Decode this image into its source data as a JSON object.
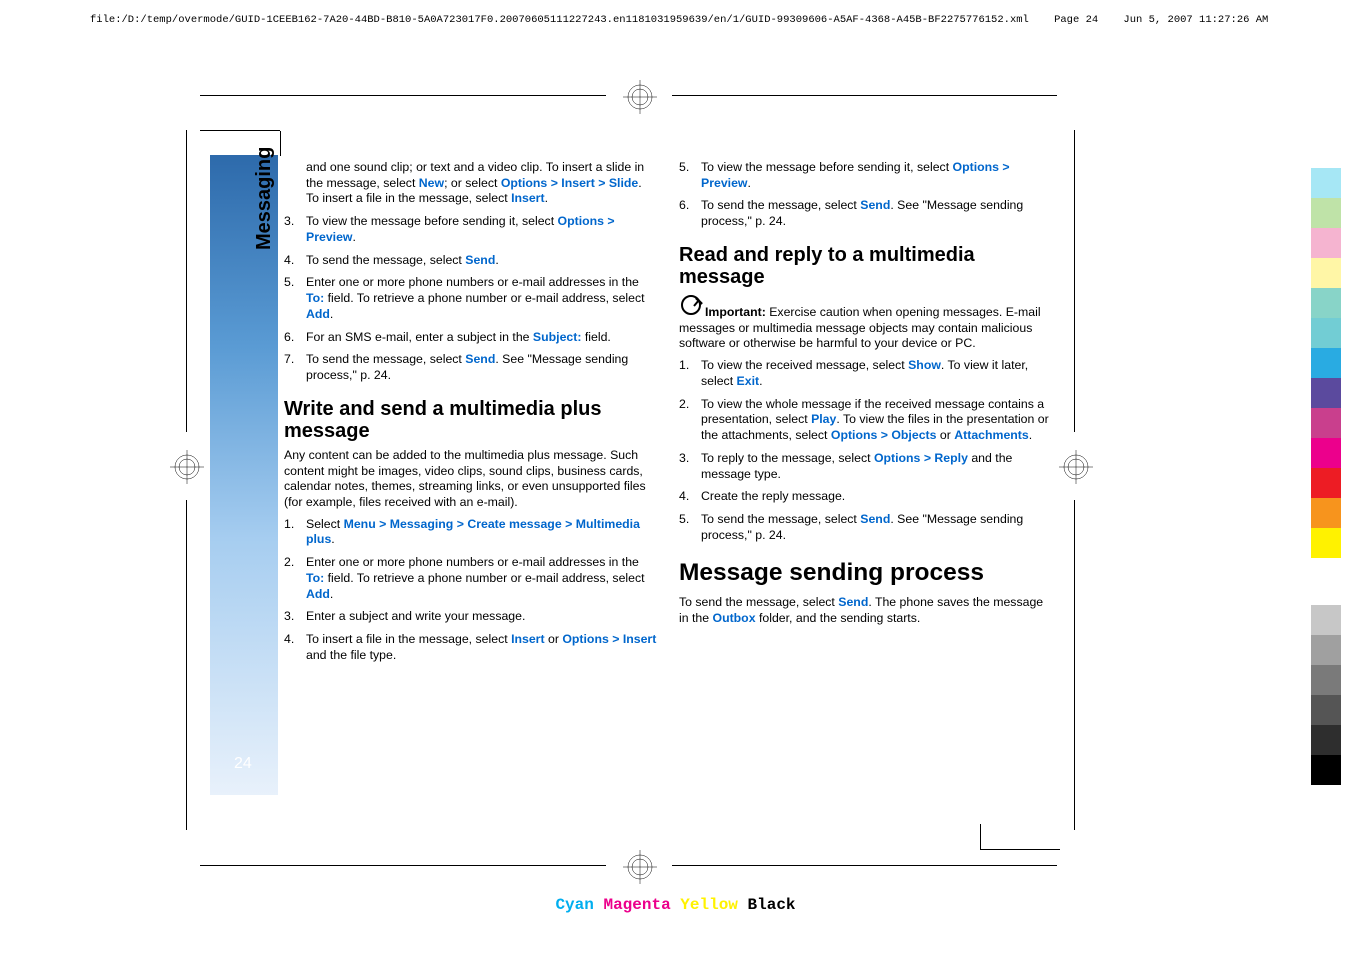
{
  "header": {
    "path": "file:/D:/temp/overmode/GUID-1CEEB162-7A20-44BD-B810-5A0A723017F0.20070605111227243.en1181031959639/en/1/GUID-99309606-A5AF-4368-A45B-BF2275776152.xml",
    "page_label": "Page 24",
    "timestamp": "Jun 5, 2007 11:27:26 AM"
  },
  "sidebar": {
    "section": "Messaging",
    "page_number": "24"
  },
  "col1": {
    "li_pre": {
      "t1": "and one sound clip; or text and a video clip. To insert a slide in the message, select ",
      "new": "New",
      "t2": "; or select ",
      "options": "Options",
      "insert": "Insert",
      "slide": "Slide",
      "t3": ". To insert a file in the message, select ",
      "insert2": "Insert",
      "t4": "."
    },
    "li3": {
      "num": "3.",
      "t1": "To view the message before sending it, select ",
      "options": "Options",
      "preview": "Preview",
      "t2": "."
    },
    "li4": {
      "num": "4.",
      "t1": "To send the message, select ",
      "send": "Send",
      "t2": "."
    },
    "li5": {
      "num": "5.",
      "t1": "Enter one or more phone numbers or e-mail addresses in the ",
      "to": "To:",
      "t2": " field. To retrieve a phone number or e-mail address, select ",
      "add": "Add",
      "t3": "."
    },
    "li6": {
      "num": "6.",
      "t1": "For an SMS e-mail, enter a subject in the ",
      "subj": "Subject:",
      "t2": " field."
    },
    "li7": {
      "num": "7.",
      "t1": "To send the message, select ",
      "send": "Send",
      "t2": ". See \"Message sending process,\" p. 24."
    },
    "h2a": "Write and send a multimedia plus message",
    "p1": "Any content can be added to the multimedia plus message. Such content might be images, video clips, sound clips, business cards, calendar notes, themes, streaming links, or even unsupported files (for example, files received with an e-mail).",
    "b_li1": {
      "num": "1.",
      "t1": "Select ",
      "menu": "Menu",
      "messaging": "Messaging",
      "create": "Create message",
      "mplus": "Multimedia plus",
      "t2": "."
    },
    "b_li2": {
      "num": "2.",
      "t1": "Enter one or more phone numbers or e-mail addresses in the ",
      "to": "To:",
      "t2": " field. To retrieve a phone number or e-mail address, select ",
      "add": "Add",
      "t3": "."
    },
    "b_li3": {
      "num": "3.",
      "t": "Enter a subject and write your message."
    },
    "b_li4": {
      "num": "4.",
      "t1": "To insert a file in the message, select ",
      "insert": "Insert",
      "t2": " or ",
      "options": "Options",
      "insert2": "Insert",
      "t3": " and the file type."
    }
  },
  "col2": {
    "li5": {
      "num": "5.",
      "t1": "To view the message before sending it, select ",
      "options": "Options",
      "preview": "Preview",
      "t2": "."
    },
    "li6": {
      "num": "6.",
      "t1": "To send the message, select ",
      "send": "Send",
      "t2": ". See \"Message sending process,\" p. 24."
    },
    "h2a": "Read and reply to a multimedia message",
    "important_label": "Important:",
    "important_text": "  Exercise caution when opening messages. E-mail messages or multimedia message objects may contain malicious software or otherwise be harmful to your device or PC.",
    "r_li1": {
      "num": "1.",
      "t1": "To view the received message, select ",
      "show": "Show",
      "t2": ". To view it later, select ",
      "exit": "Exit",
      "t3": "."
    },
    "r_li2": {
      "num": "2.",
      "t1": "To view the whole message if the received message contains a presentation, select ",
      "play": "Play",
      "t2": ". To view the files in the presentation or the attachments, select ",
      "options": "Options",
      "objects": "Objects",
      "t3": " or ",
      "attach": "Attachments",
      "t4": "."
    },
    "r_li3": {
      "num": "3.",
      "t1": "To reply to the message, select ",
      "options": "Options",
      "reply": "Reply",
      "t2": " and the message type."
    },
    "r_li4": {
      "num": "4.",
      "t": "Create the reply message."
    },
    "r_li5": {
      "num": "5.",
      "t1": "To send the message, select ",
      "send": "Send",
      "t2": ". See \"Message sending process,\" p. 24."
    },
    "h1": "Message sending process",
    "p_end": {
      "t1": "To send the message, select ",
      "send": "Send",
      "t2": ". The phone saves the message in the ",
      "outbox": "Outbox",
      "t3": " folder, and the sending starts."
    }
  },
  "footer": {
    "cyan": "Cyan",
    "magenta": "Magenta",
    "yellow": "Yellow",
    "black": "Black"
  },
  "colors_right": [
    "#a6e7f5",
    "#bfe3a8",
    "#f5b4d0",
    "#fff6a6",
    "#88d4c8",
    "#72cdd4",
    "#29abe2",
    "#5b4a9e",
    "#c93f8d",
    "#ec008c",
    "#ed1c24",
    "#f7941d",
    "#fff200"
  ],
  "grays_right": [
    "#c7c7c7",
    "#a0a0a0",
    "#7a7a7a",
    "#555555",
    "#2e2e2e",
    "#000000"
  ],
  "gt_symbol": ">"
}
